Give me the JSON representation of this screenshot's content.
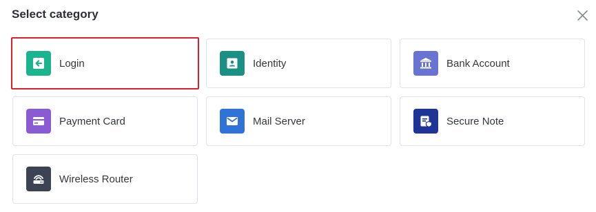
{
  "dialog": {
    "title": "Select category",
    "close_icon": "close-icon"
  },
  "categories": [
    {
      "label": "Login",
      "icon": "login-icon",
      "color": "#1bb48f",
      "selected": true
    },
    {
      "label": "Identity",
      "icon": "identity-icon",
      "color": "#1a8f83"
    },
    {
      "label": "Bank Account",
      "icon": "bank-icon",
      "color": "#6874cf"
    },
    {
      "label": "Payment Card",
      "icon": "credit-card-icon",
      "color": "#8a5bd3"
    },
    {
      "label": "Mail Server",
      "icon": "mail-icon",
      "color": "#2f73d6"
    },
    {
      "label": "Secure Note",
      "icon": "secure-note-icon",
      "color": "#1f3596"
    },
    {
      "label": "Wireless Router",
      "icon": "router-icon",
      "color": "#3c4453"
    }
  ],
  "selection_highlight_color": "#e01e28"
}
